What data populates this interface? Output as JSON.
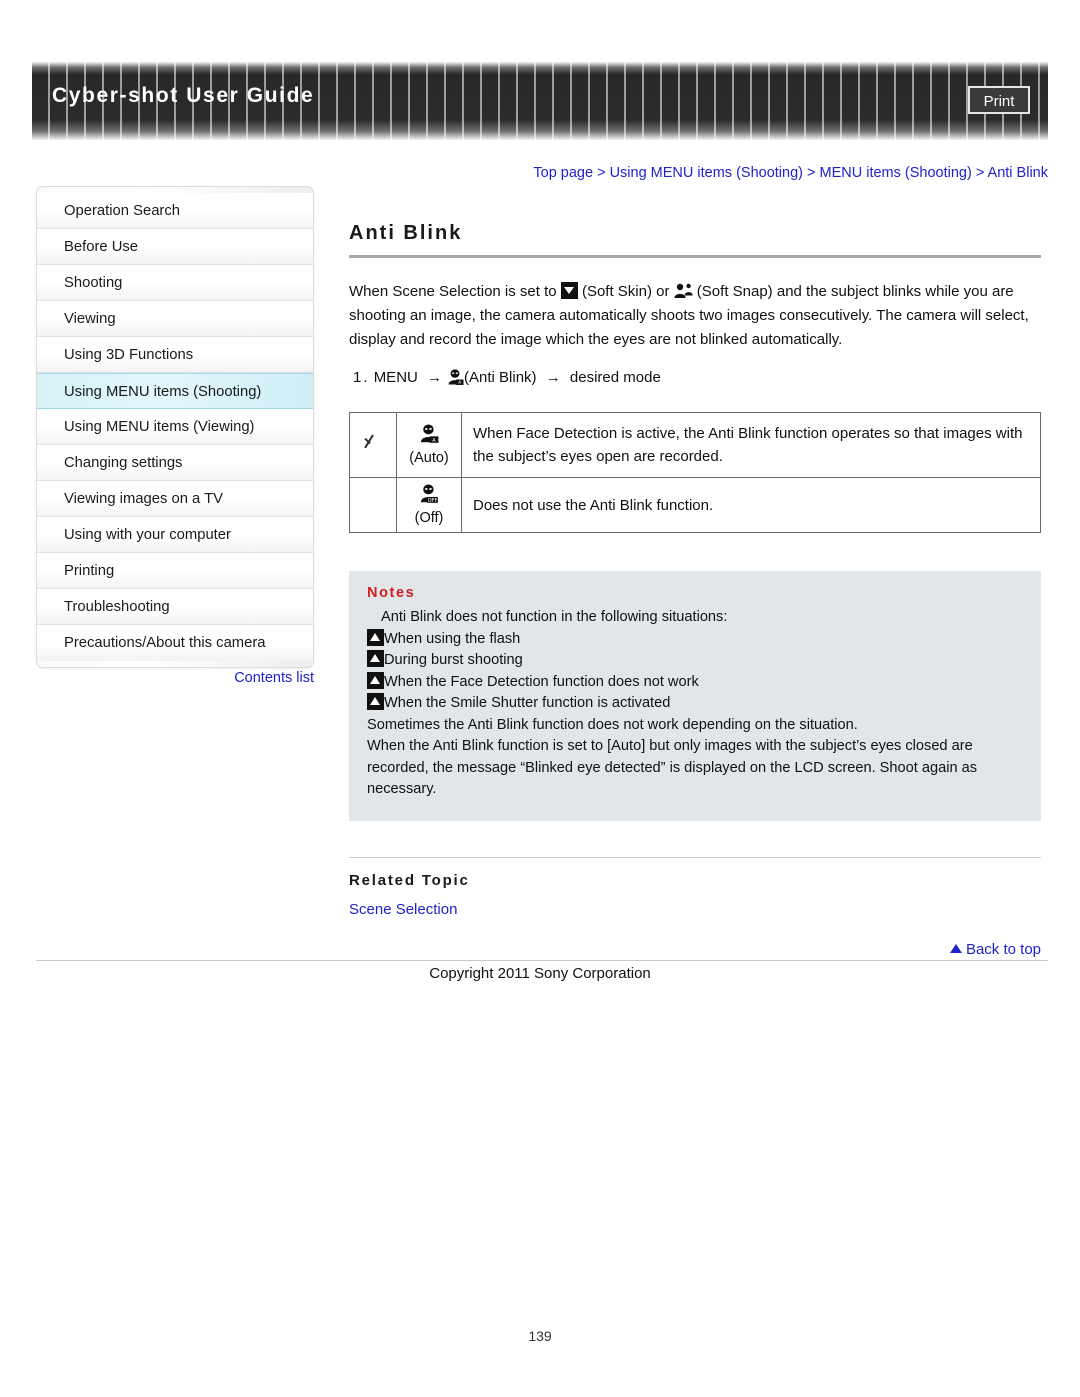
{
  "header": {
    "title": "Cyber-shot User Guide",
    "print_label": "Print"
  },
  "breadcrumb": {
    "items": [
      "Top page",
      "Using MENU items (Shooting)",
      "MENU items (Shooting)",
      "Anti Blink"
    ],
    "separator": ">"
  },
  "sidebar": {
    "items": [
      {
        "label": "Operation Search",
        "active": false
      },
      {
        "label": "Before Use",
        "active": false
      },
      {
        "label": "Shooting",
        "active": false
      },
      {
        "label": "Viewing",
        "active": false
      },
      {
        "label": "Using 3D Functions",
        "active": false
      },
      {
        "label": "Using MENU items (Shooting)",
        "active": true
      },
      {
        "label": "Using MENU items (Viewing)",
        "active": false
      },
      {
        "label": "Changing settings",
        "active": false
      },
      {
        "label": "Viewing images on a TV",
        "active": false
      },
      {
        "label": "Using with your computer",
        "active": false
      },
      {
        "label": "Printing",
        "active": false
      },
      {
        "label": "Troubleshooting",
        "active": false
      },
      {
        "label": "Precautions/About this camera",
        "active": false
      }
    ],
    "contents_list_label": "Contents list"
  },
  "main": {
    "title": "Anti Blink",
    "paragraph_part1": "When Scene Selection is set to ",
    "paragraph_part2": " (Soft Skin) or ",
    "paragraph_part3": " (Soft Snap) and the subject blinks while you are shooting an image, the camera automatically shoots two images consecutively. The camera will select, display and record the image which the eyes are not blinked automatically.",
    "step": {
      "number": "1.",
      "menu_label": "MENU",
      "arrow": "→",
      "icon_label": "(Anti Blink)",
      "target": "desired mode"
    },
    "table": {
      "rows": [
        {
          "checked": true,
          "icon_badge": "AUTO",
          "option": "(Auto)",
          "description": "When Face Detection is active, the Anti Blink function operates so that images with the subject’s eyes open are recorded."
        },
        {
          "checked": false,
          "icon_badge": "OFF",
          "option": "(Off)",
          "description": "Does not use the Anti Blink function."
        }
      ]
    },
    "notes": {
      "heading": "Notes",
      "intro": "Anti Blink does not function in the following situations:",
      "bullets": [
        "When using the flash",
        "During burst shooting",
        "When the Face Detection function does not work",
        "When the Smile Shutter function is activated"
      ],
      "paragraphs": [
        "Sometimes the Anti Blink function does not work depending on the situation.",
        "When the Anti Blink function is set to [Auto] but only images with the subject’s eyes closed are recorded, the message “Blinked eye detected” is displayed on the LCD screen. Shoot again as necessary."
      ]
    },
    "related": {
      "heading": "Related Topic",
      "links": [
        "Scene Selection"
      ]
    }
  },
  "footer": {
    "back_to_top": "Back to top",
    "copyright": "Copyright 2011 Sony Corporation",
    "page_number": "139"
  },
  "colors": {
    "link": "#2222cc",
    "notes_heading": "#d02020",
    "active_nav": "#d6f3f8",
    "notes_bg": "#e2e6e9"
  }
}
